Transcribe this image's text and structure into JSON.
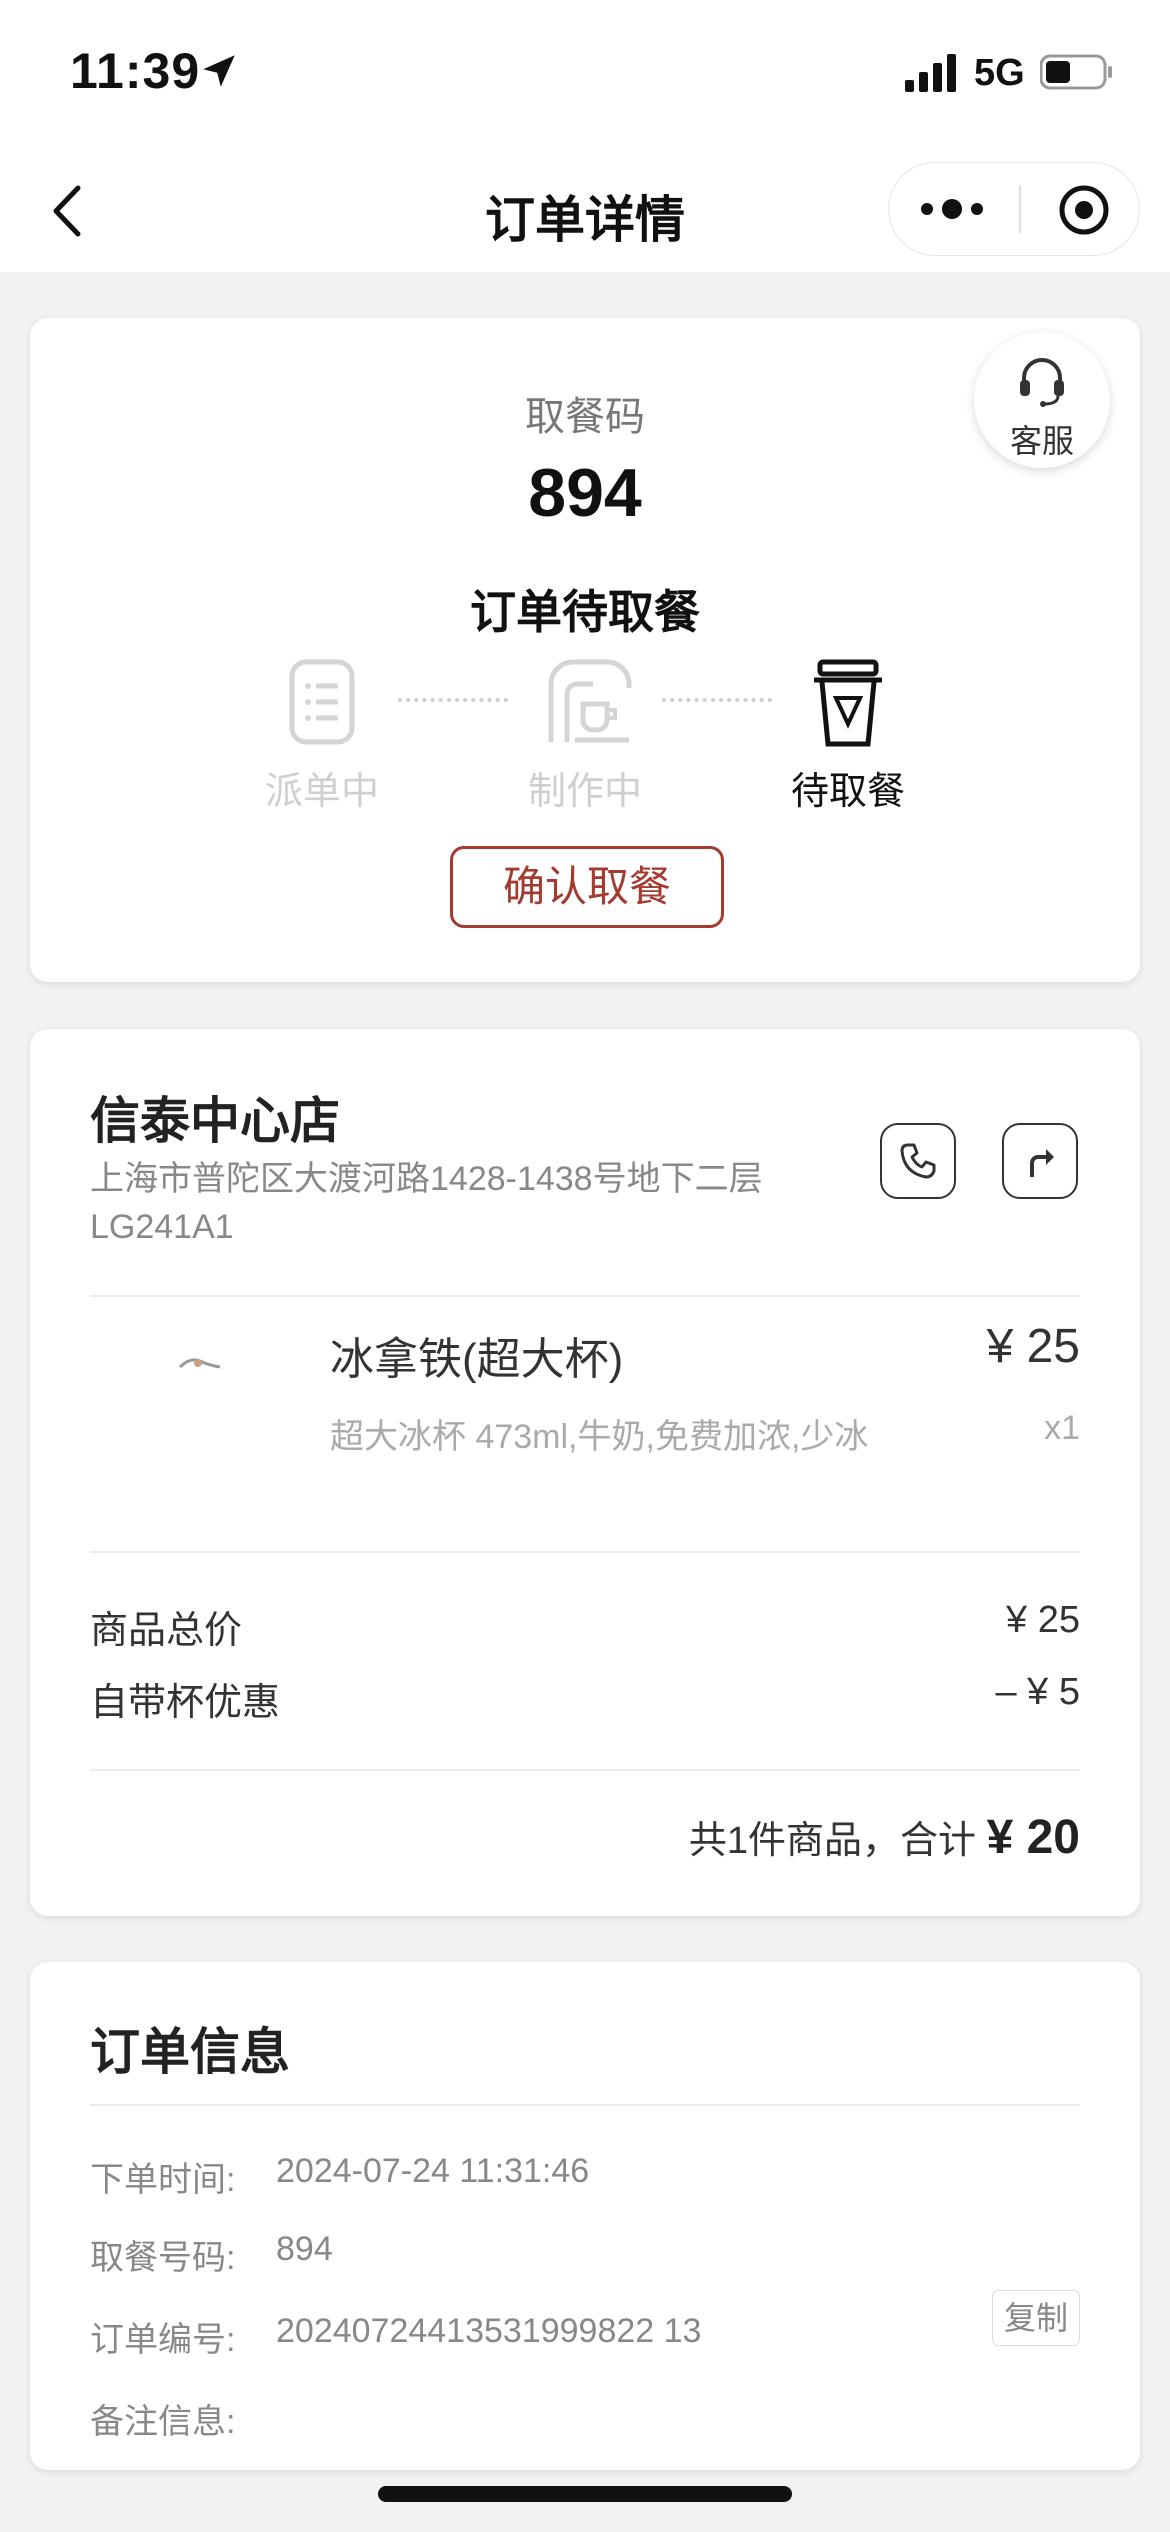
{
  "status_bar": {
    "time": "11:39",
    "network": "5G"
  },
  "nav": {
    "title": "订单详情"
  },
  "pickup": {
    "label": "取餐码",
    "code": "894",
    "status_text": "订单待取餐",
    "service_label": "客服",
    "steps": [
      {
        "label": "派单中",
        "state": "inactive",
        "icon": "receipt-icon"
      },
      {
        "label": "制作中",
        "state": "inactive",
        "icon": "coffee-machine-icon"
      },
      {
        "label": "待取餐",
        "state": "active",
        "icon": "cup-icon"
      }
    ],
    "confirm_label": "确认取餐"
  },
  "store": {
    "name": "信泰中心店",
    "address": "上海市普陀区大渡河路1428-1438号地下二层LG241A1"
  },
  "item": {
    "name": "冰拿铁(超大杯)",
    "price": "¥ 25",
    "spec": "超大冰杯 473ml,牛奶,免费加浓,少冰",
    "qty": "x1"
  },
  "pricing": {
    "subtotal_label": "商品总价",
    "subtotal_value": "¥ 25",
    "discount_label": "自带杯优惠",
    "discount_value": "– ¥ 5",
    "summary_prefix": "共1件商品，合计 ",
    "summary_total": "¥ 20"
  },
  "order_info": {
    "title": "订单信息",
    "time_label": "下单时间:",
    "time_value": "2024-07-24 11:31:46",
    "code_label": "取餐号码:",
    "code_value": "894",
    "order_no_label": "订单编号:",
    "order_no_value": "20240724413531999822 13",
    "copy_label": "复制",
    "note_label": "备注信息:"
  },
  "colors": {
    "accent": "#a53a30",
    "background": "#f2f2f2"
  }
}
